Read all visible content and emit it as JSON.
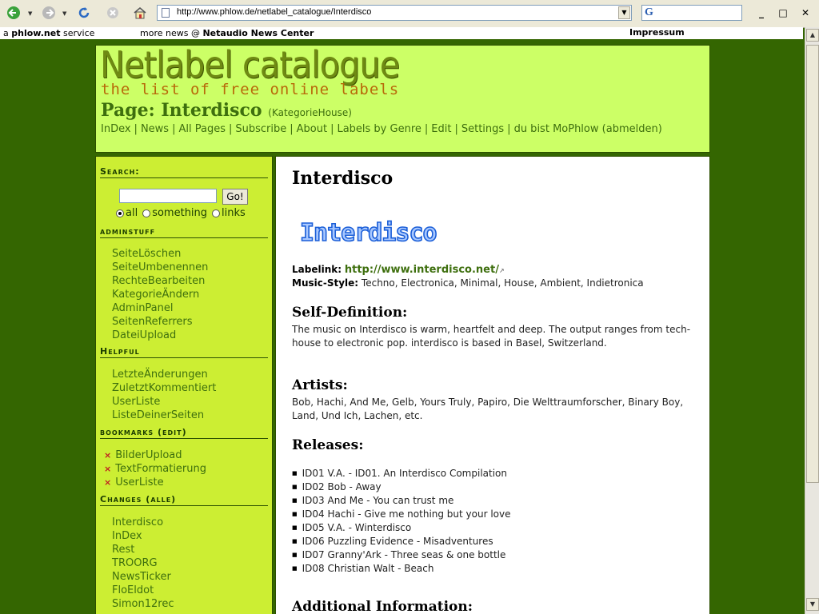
{
  "browser": {
    "url": "http://www.phlow.de/netlabel_catalogue/Interdisco",
    "search_icon": "google-search-icon",
    "window_buttons": [
      "_",
      "□",
      "✕"
    ]
  },
  "infobar": {
    "service_prefix": "a",
    "service_name": "phlow.net",
    "service_suffix": "service",
    "news_prefix": "more news @",
    "news_name": "Netaudio News Center",
    "impressum": "Impressum"
  },
  "header": {
    "logo_title": "Netlabel catalogue",
    "logo_subtitle": "the list of free online labels",
    "page_title": "Page: Interdisco",
    "category": "(KategorieHouse)",
    "nav": [
      "InDex",
      "News",
      "All Pages",
      "Subscribe",
      "About",
      "Labels by Genre",
      "Edit",
      "Settings"
    ],
    "user_prefix": "du bist",
    "user_name": "MoPhlow",
    "logout": "(abmelden)"
  },
  "sidebar": {
    "search_heading": "Search:",
    "search_button": "Go!",
    "search_value": "",
    "radios": [
      {
        "label": "all",
        "checked": true
      },
      {
        "label": "something",
        "checked": false
      },
      {
        "label": "links",
        "checked": false
      }
    ],
    "adminstuff_heading": "adminstuff",
    "adminstuff": [
      "SeiteLöschen",
      "SeiteUmbenennen",
      "RechteBearbeiten",
      "KategorieÄndern",
      "AdminPanel",
      "SeitenReferrers",
      "DateiUpload"
    ],
    "helpful_heading": "Helpful",
    "helpful": [
      "LetzteÄnderungen",
      "ZuletztKommentiert",
      "UserListe",
      "ListeDeinerSeiten"
    ],
    "bookmarks_heading": "bookmarks",
    "bookmarks_edit": "edit",
    "bookmarks": [
      "BilderUpload",
      "TextFormatierung",
      "UserListe"
    ],
    "changes_heading": "Changes",
    "changes_all": "alle",
    "changes": [
      "Interdisco",
      "InDex",
      "Rest",
      "TROORG",
      "NewsTicker",
      "FloEldot",
      "Simon12rec"
    ]
  },
  "main": {
    "title": "Interdisco",
    "logo_text": "Interdisco",
    "labellink_label": "Labelink:",
    "labellink_url": "http://www.interdisco.net/",
    "music_style_label": "Music-Style:",
    "music_style": "Techno, Electronica, Minimal, House, Ambient, Indietronica",
    "self_def_heading": "Self-Definition:",
    "self_def_text": "The music on Interdisco is warm, heartfelt and deep. The output ranges from tech-house to electronic pop. interdisco is based in Basel, Switzerland.",
    "artists_heading": "Artists:",
    "artists_text": "Bob, Hachi, And Me, Gelb, Yours Truly, Papiro, Die Welttraumforscher, Binary Boy, Land, Und Ich, Lachen, etc.",
    "releases_heading": "Releases:",
    "releases": [
      "ID01 V.A. - ID01. An Interdisco Compilation",
      "ID02 Bob - Away",
      "ID03 And Me - You can trust me",
      "ID04 Hachi - Give me nothing but your love",
      "ID05 V.A. - Winterdisco",
      "ID06 Puzzling Evidence - Misadventures",
      "ID07 Granny'Ark - Three seas & one bottle",
      "ID08 Christian Walt - Beach"
    ],
    "additional_heading": "Additional Information:"
  }
}
